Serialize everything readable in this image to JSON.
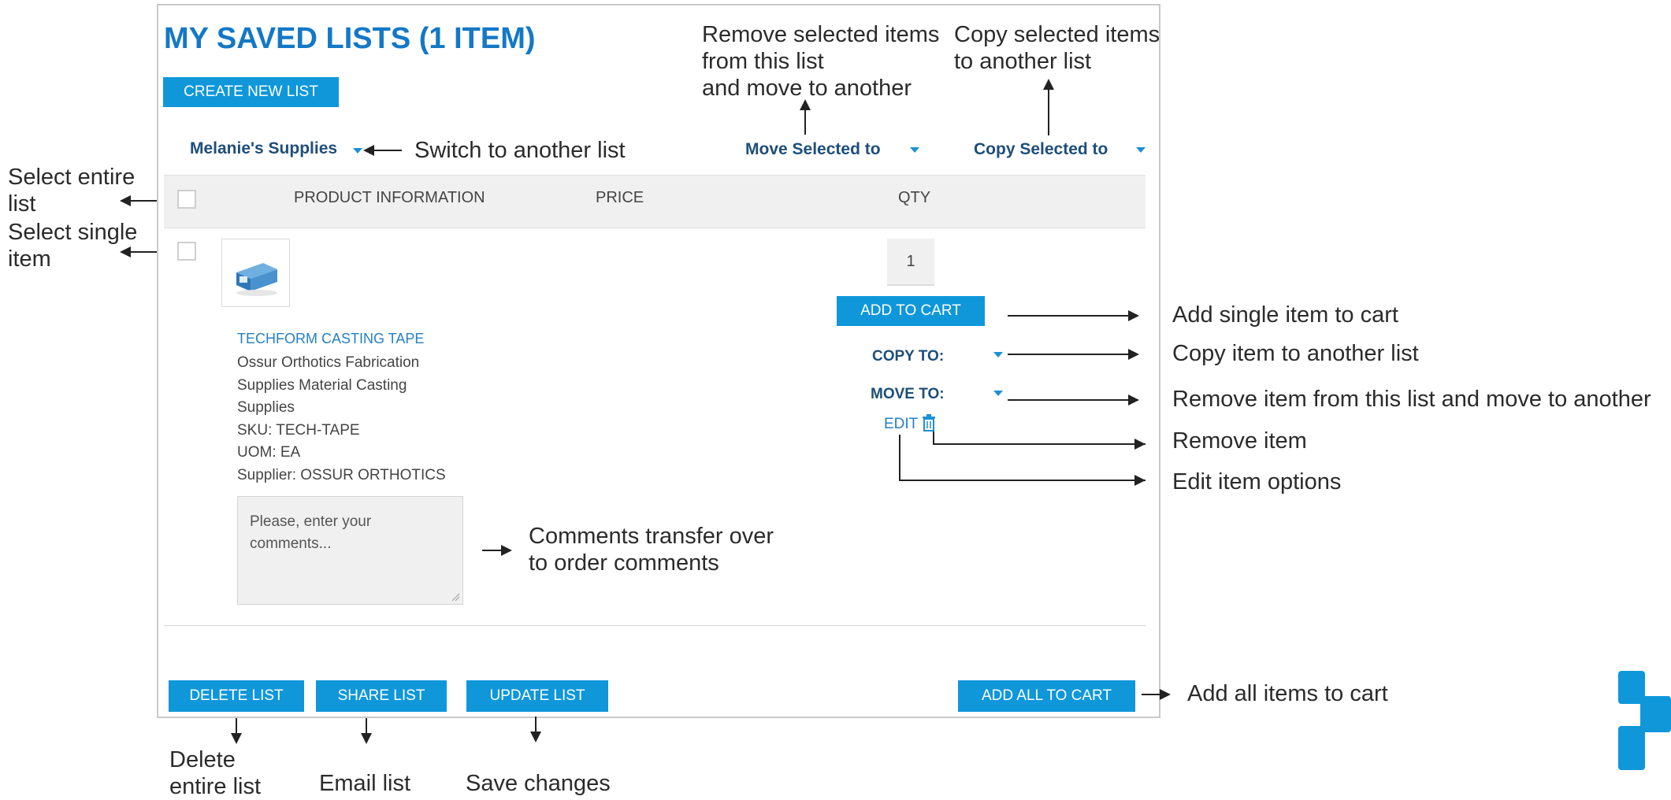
{
  "page": {
    "title": "MY SAVED LISTS (1 ITEM)",
    "create_button": "CREATE NEW LIST",
    "list_selector": "Melanie's Supplies",
    "move_selected": "Move Selected to",
    "copy_selected": "Copy Selected to"
  },
  "table": {
    "headers": [
      "PRODUCT INFORMATION",
      "PRICE",
      "QTY"
    ]
  },
  "item": {
    "name": "TECHFORM CASTING TAPE",
    "desc_lines": [
      "Ossur Orthotics Fabrication",
      "Supplies Material Casting",
      "Supplies"
    ],
    "sku": "SKU: TECH-TAPE",
    "uom": "UOM: EA",
    "supplier": "Supplier: OSSUR ORTHOTICS",
    "qty": "1",
    "add_to_cart": "ADD TO CART",
    "copy_to": "COPY TO:",
    "move_to": "MOVE TO:",
    "edit": "EDIT",
    "comments_placeholder": "Please, enter your comments..."
  },
  "footer": {
    "delete": "DELETE LIST",
    "share": "SHARE LIST",
    "update": "UPDATE LIST",
    "add_all": "ADD ALL TO CART"
  },
  "annotations": {
    "remove_selected": [
      "Remove selected items",
      "from this list",
      "and move to another"
    ],
    "copy_selected": [
      "Copy selected items",
      "to another list"
    ],
    "switch_list": "Switch to another list",
    "select_entire": [
      "Select entire",
      "list"
    ],
    "select_single": [
      "Select single",
      "item"
    ],
    "add_single": "Add single item to cart",
    "copy_item": "Copy item to another list",
    "move_item": "Remove item from this list and move to another",
    "remove_item": "Remove item",
    "edit_item": "Edit item options",
    "comments": [
      "Comments transfer over",
      "to order comments"
    ],
    "add_all": "Add all items to cart",
    "delete_entire": [
      "Delete",
      "entire list"
    ],
    "email_list": "Email list",
    "save_changes": "Save changes"
  },
  "icons": [
    "trash-icon",
    "caret-down-icon",
    "product-thumbnail",
    "brand-logo"
  ],
  "colors": {
    "accent": "#0f97da",
    "title": "#1478c6",
    "navy": "#1e4e79"
  }
}
